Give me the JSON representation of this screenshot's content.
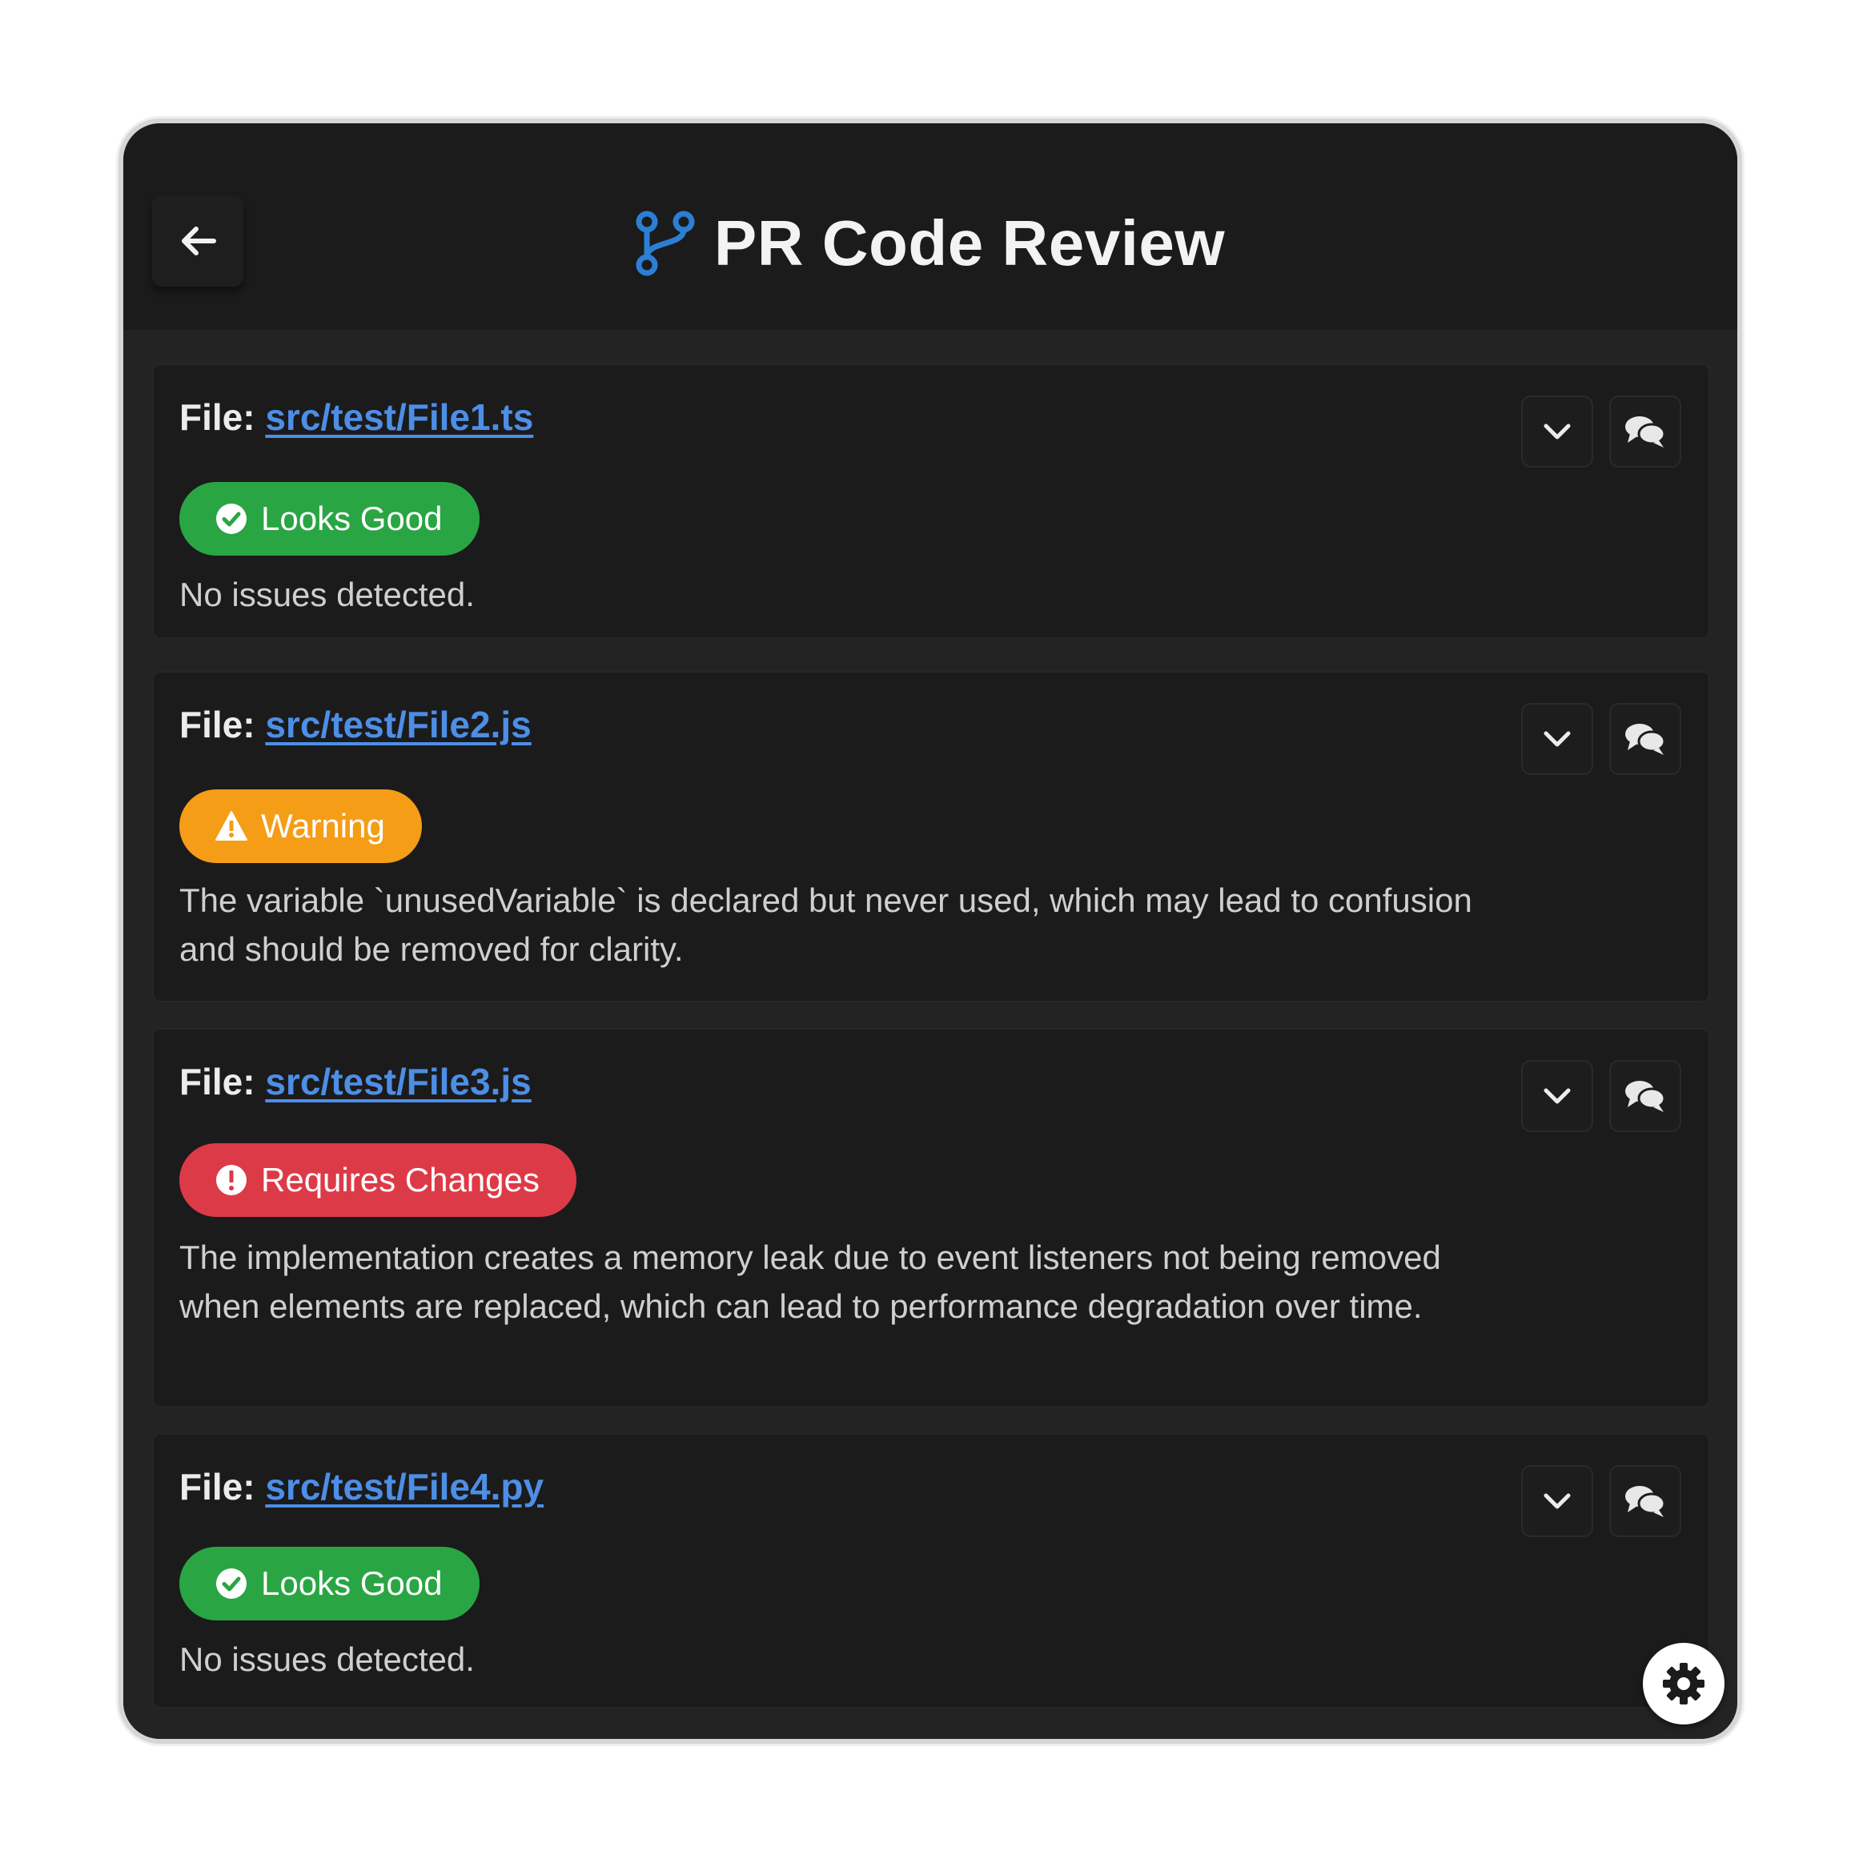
{
  "header": {
    "title": "PR Code Review",
    "back_icon": "arrow-left-icon",
    "branch_icon": "git-branch-icon",
    "accent_color": "#2b7fd4"
  },
  "files": [
    {
      "label": "File:",
      "path": "src/test/File1.ts",
      "status": "good",
      "status_label": "Looks Good",
      "status_icon": "check-circle-icon",
      "description": "No issues detected."
    },
    {
      "label": "File:",
      "path": "src/test/File2.js",
      "status": "warning",
      "status_label": "Warning",
      "status_icon": "warning-triangle-icon",
      "description": "The variable `unusedVariable` is declared but never used, which may lead to confusion and should be removed for clarity."
    },
    {
      "label": "File:",
      "path": "src/test/File3.js",
      "status": "error",
      "status_label": "Requires Changes",
      "status_icon": "exclamation-circle-icon",
      "description": "The implementation creates a memory leak due to event listeners not being removed when elements are replaced, which can lead to performance degradation over time."
    },
    {
      "label": "File:",
      "path": "src/test/File4.py",
      "status": "good",
      "status_label": "Looks Good",
      "status_icon": "check-circle-icon",
      "description": "No issues detected."
    }
  ],
  "colors": {
    "good": "#2aa543",
    "warning": "#f59d17",
    "error": "#dd3a48",
    "link": "#4d8ee6"
  },
  "settings": {
    "icon": "gear-icon"
  }
}
